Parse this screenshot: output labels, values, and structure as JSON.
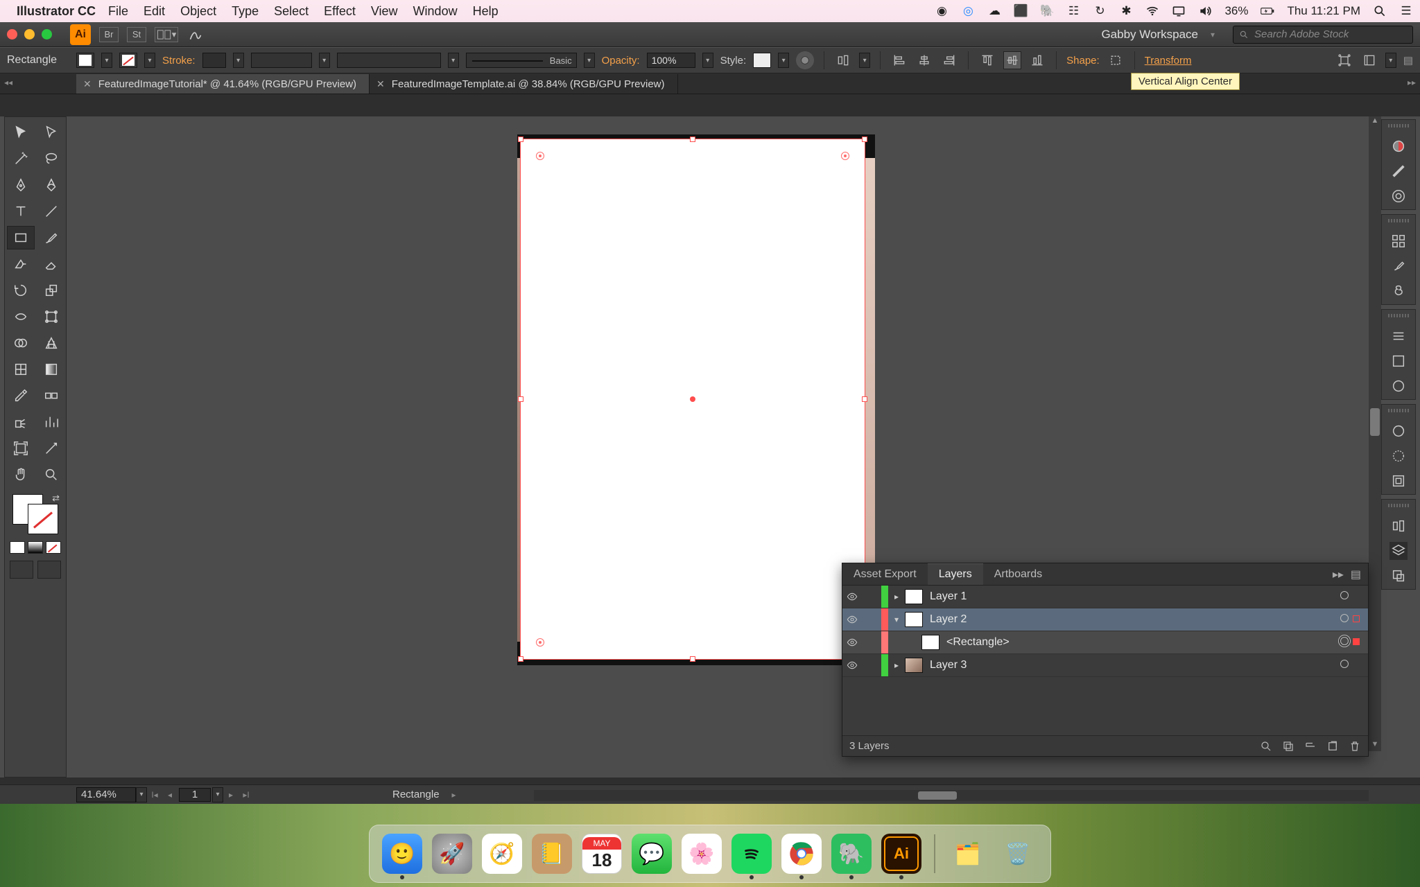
{
  "mac_menu": {
    "app_name": "Illustrator CC",
    "items": [
      "File",
      "Edit",
      "Object",
      "Type",
      "Select",
      "Effect",
      "View",
      "Window",
      "Help"
    ],
    "battery_text": "36%",
    "clock": "Thu 11:21 PM"
  },
  "app_top": {
    "ai_badge": "Ai",
    "br_badge": "Br",
    "st_badge": "St",
    "workspace": "Gabby Workspace",
    "search_placeholder": "Search Adobe Stock"
  },
  "options": {
    "selection_label": "Rectangle",
    "stroke_label": "Stroke:",
    "brush_label": "Basic",
    "opacity_label": "Opacity:",
    "opacity_value": "100%",
    "style_label": "Style:",
    "shape_label": "Shape:",
    "transform_label": "Transform",
    "tooltip": "Vertical Align Center"
  },
  "tabs": {
    "tab1": "FeaturedImageTutorial* @ 41.64% (RGB/GPU Preview)",
    "tab2": "FeaturedImageTemplate.ai @ 38.84% (RGB/GPU Preview)"
  },
  "layers_panel": {
    "tab_asset": "Asset Export",
    "tab_layers": "Layers",
    "tab_artboards": "Artboards",
    "rows": {
      "layer1": "Layer 1",
      "layer2": "Layer 2",
      "rect": "<Rectangle>",
      "layer3": "Layer 3"
    },
    "footer_count": "3 Layers"
  },
  "status": {
    "zoom": "41.64%",
    "artboard_num": "1",
    "selection": "Rectangle"
  },
  "dock_calendar": {
    "month": "MAY",
    "day": "18"
  }
}
